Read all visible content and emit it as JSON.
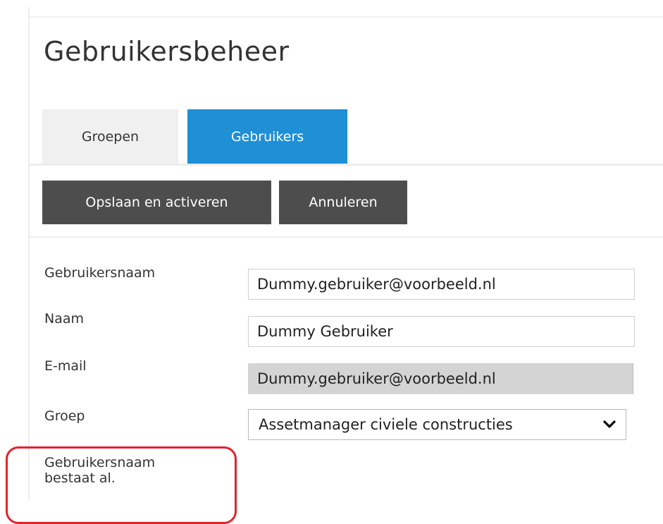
{
  "page": {
    "title": "Gebruikersbeheer"
  },
  "tabs": [
    {
      "label": "Groepen",
      "active": false
    },
    {
      "label": "Gebruikers",
      "active": true
    }
  ],
  "toolbar": {
    "save_label": "Opslaan en activeren",
    "cancel_label": "Annuleren"
  },
  "form": {
    "username": {
      "label": "Gebruikersnaam",
      "value": "Dummy.gebruiker@voorbeeld.nl"
    },
    "name": {
      "label": "Naam",
      "value": "Dummy Gebruiker"
    },
    "email": {
      "label": "E-mail",
      "value": "Dummy.gebruiker@voorbeeld.nl",
      "readonly": true
    },
    "group": {
      "label": "Groep",
      "value": "Assetmanager civiele constructies"
    }
  },
  "error": {
    "line1": "Gebruikersnaam",
    "line2": "bestaat al."
  },
  "colors": {
    "accent": "#1f8fd6",
    "button": "#4d4d4d",
    "error_highlight": "#e0242c"
  }
}
